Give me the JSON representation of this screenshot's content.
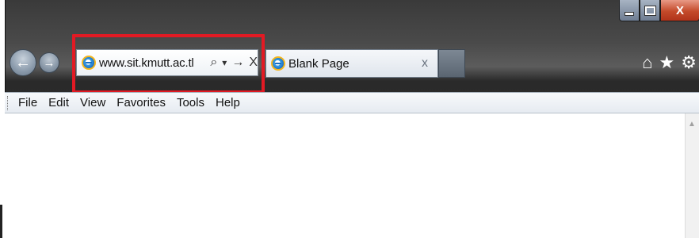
{
  "window": {
    "caption": {
      "minimize": "",
      "maximize": "",
      "close": "X"
    }
  },
  "nav": {
    "back_icon": "←",
    "forward_icon": "→"
  },
  "address_bar": {
    "url": "www.sit.kmutt.ac.tl",
    "search_icon": "⌕",
    "dropdown_icon": "▾",
    "go_icon": "→",
    "stop_icon": "X"
  },
  "tabs": [
    {
      "label": "Blank Page",
      "close": "x"
    }
  ],
  "toolbar_right": {
    "home_icon": "⌂",
    "favorites_icon": "★",
    "tools_icon": "⚙"
  },
  "menu": [
    "File",
    "Edit",
    "View",
    "Favorites",
    "Tools",
    "Help"
  ],
  "scrollbar": {
    "up_icon": "▲"
  },
  "colors": {
    "highlight": "#e21a24",
    "close_button": "#c44a2a"
  }
}
